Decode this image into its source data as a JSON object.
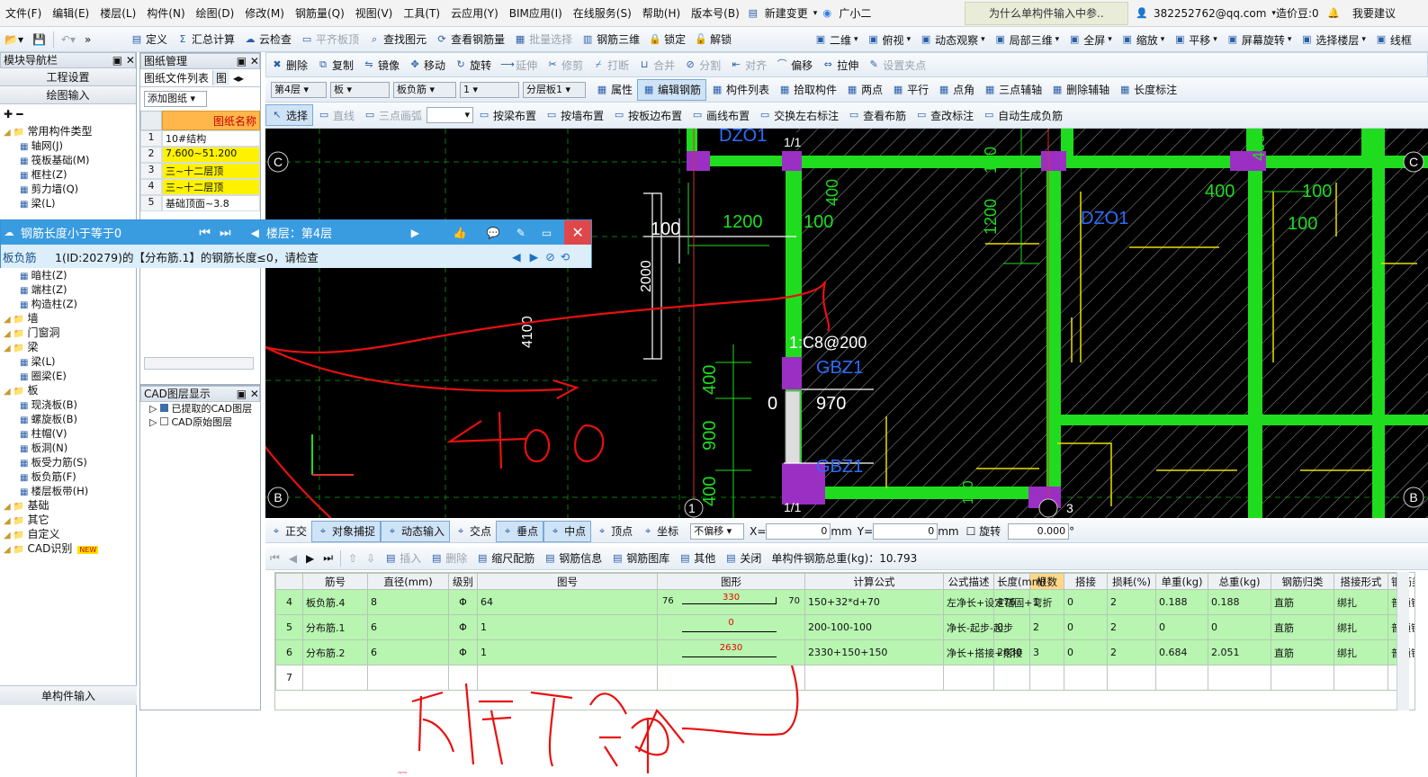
{
  "menu": [
    "文件(F)",
    "编辑(E)",
    "楼层(L)",
    "构件(N)",
    "绘图(D)",
    "修改(M)",
    "钢筋量(Q)",
    "视图(V)",
    "工具(T)",
    "云应用(Y)",
    "BIM应用(I)",
    "在线服务(S)",
    "帮助(H)",
    "版本号(B)"
  ],
  "menu_right": {
    "new_change": "新建变更",
    "xiaoer": "广小二",
    "question": "为什么单构件输入中参..",
    "account": "382252762@qq.com",
    "price_bean": "造价豆:0",
    "want_feedback": "我要建议"
  },
  "toolbar2": [
    "定义",
    "汇总计算",
    "云检查",
    "平齐板顶",
    "查找图元",
    "查看钢筋量",
    "批量选择",
    "钢筋三维",
    "锁定",
    "解锁"
  ],
  "toolbar2_right": [
    "二维",
    "俯视",
    "动态观察",
    "局部三维",
    "全屏",
    "缩放",
    "平移",
    "屏幕旋转",
    "选择楼层",
    "线框"
  ],
  "nav": {
    "title": "模块导航栏",
    "project_settings": "工程设置",
    "drawing_input": "绘图输入",
    "tree": [
      {
        "label": "常用构件类型",
        "level": 0
      },
      {
        "label": "轴网(J)",
        "level": 1
      },
      {
        "label": "筏板基础(M)",
        "level": 1
      },
      {
        "label": "框柱(Z)",
        "level": 1
      },
      {
        "label": "剪力墙(Q)",
        "level": 1
      },
      {
        "label": "梁(L)",
        "level": 1
      },
      {
        "label": "暗柱(Z)",
        "level": 1
      },
      {
        "label": "端柱(Z)",
        "level": 1
      },
      {
        "label": "构造柱(Z)",
        "level": 1
      },
      {
        "label": "墙",
        "level": 0
      },
      {
        "label": "门窗洞",
        "level": 0
      },
      {
        "label": "梁",
        "level": 0
      },
      {
        "label": "梁(L)",
        "level": 1
      },
      {
        "label": "圈梁(E)",
        "level": 1
      },
      {
        "label": "板",
        "level": 0
      },
      {
        "label": "现浇板(B)",
        "level": 1
      },
      {
        "label": "螺旋板(B)",
        "level": 1
      },
      {
        "label": "柱帽(V)",
        "level": 1
      },
      {
        "label": "板洞(N)",
        "level": 1
      },
      {
        "label": "板受力筋(S)",
        "level": 1
      },
      {
        "label": "板负筋(F)",
        "level": 1
      },
      {
        "label": "楼层板带(H)",
        "level": 1
      },
      {
        "label": "基础",
        "level": 0
      },
      {
        "label": "其它",
        "level": 0
      },
      {
        "label": "自定义",
        "level": 0
      },
      {
        "label": "CAD识别",
        "level": 0
      }
    ],
    "new_badge": "NEW",
    "single_input": "单构件输入"
  },
  "drawings": {
    "title": "图纸管理",
    "tab1": "图纸文件列表",
    "tab2": "图",
    "add": "添加图纸",
    "col": "图纸名称",
    "rows": [
      {
        "n": "1",
        "name": "10#结构"
      },
      {
        "n": "2",
        "name": "7.600~51.200"
      },
      {
        "n": "3",
        "name": "三~十二层顶"
      },
      {
        "n": "4",
        "name": "三~十二层顶"
      },
      {
        "n": "5",
        "name": "基础顶面~3.8"
      }
    ],
    "cad_title": "CAD图层显示",
    "cad_items": [
      "已提取的CAD图层",
      "CAD原始图层"
    ]
  },
  "editbar": [
    "删除",
    "复制",
    "镜像",
    "移动",
    "旋转",
    "延伸",
    "修剪",
    "打断",
    "合并",
    "分割",
    "对齐",
    "偏移",
    "拉伸",
    "设置夹点"
  ],
  "layerbar": {
    "floor": "第4层",
    "type": "板",
    "sub": "板负筋",
    "num": "1",
    "slab": "分层板1",
    "items": [
      "属性",
      "编辑钢筋",
      "构件列表",
      "拾取构件",
      "两点",
      "平行",
      "点角",
      "三点辅轴",
      "删除辅轴",
      "长度标注"
    ]
  },
  "drawbar": [
    "选择",
    "直线",
    "三点画弧",
    "按梁布置",
    "按墙布置",
    "按板边布置",
    "画线布置",
    "交换左右标注",
    "查看布筋",
    "查改标注",
    "自动生成负筋"
  ],
  "popup": {
    "title": "钢筋长度小于等于0",
    "floor": "楼层：第4层",
    "left": "板负筋",
    "msg": "1(ID:20279)的【分布筋.1】的钢筋长度≤0，请检查"
  },
  "cad": {
    "axis_left": [
      "C",
      "B"
    ],
    "axis_right": [
      "C",
      "B"
    ],
    "dims": [
      "100",
      "1200",
      "100",
      "2000",
      "4100",
      "400",
      "900",
      "400",
      "400",
      "100",
      "1200",
      "400",
      "100",
      "970",
      "0",
      "100",
      "1/1",
      "1/1",
      "1",
      "3",
      "100",
      "400"
    ],
    "rebar_label": "1:C8@200",
    "tags": [
      "DZO1",
      "DZO1",
      "GBZ1",
      "GBZ1"
    ],
    "handwriting": [
      "4100",
      "长度不合适"
    ]
  },
  "snapbar": {
    "items": [
      "正交",
      "对象捕捉",
      "动态输入",
      "交点",
      "垂点",
      "中点",
      "顶点",
      "坐标"
    ],
    "offset": "不偏移",
    "x_label": "X=",
    "x": "0",
    "mm1": "mm",
    "y_label": "Y=",
    "y": "0",
    "mm2": "mm",
    "rotate": "旋转",
    "rot": "0.000",
    "deg": "°"
  },
  "gridbar": {
    "items": [
      "插入",
      "删除",
      "缩尺配筋",
      "钢筋信息",
      "钢筋图库",
      "其他",
      "关闭"
    ],
    "total": "单构件钢筋总重(kg)：10.793"
  },
  "table": {
    "headers": [
      "筋号",
      "直径(mm)",
      "级别",
      "图号",
      "图形",
      "计算公式",
      "公式描述",
      "长度(mm)",
      "根数",
      "搭接",
      "损耗(%)",
      "单重(kg)",
      "总重(kg)",
      "钢筋归类",
      "搭接形式",
      "钢筋类型"
    ],
    "rows": [
      {
        "idx": "4",
        "name": "板负筋.4",
        "d": "8",
        "grade": "Φ",
        "fig": "64",
        "shape_l": "76",
        "shape_m": "330",
        "shape_r": "70",
        "formula": "150+32*d+70",
        "desc": "左净长+设定锚固+弯折",
        "len": "476",
        "count": "1",
        "lap": "0",
        "loss": "2",
        "uw": "0.188",
        "tw": "0.188",
        "cat": "直筋",
        "lapf": "绑扎",
        "type": "普通钢筋"
      },
      {
        "idx": "5",
        "name": "分布筋.1",
        "d": "6",
        "grade": "Φ",
        "fig": "1",
        "shape_l": "",
        "shape_m": "0",
        "shape_r": "",
        "formula": "200-100-100",
        "desc": "净长-起步-起步",
        "len": "0",
        "count": "2",
        "lap": "0",
        "loss": "2",
        "uw": "0",
        "tw": "0",
        "cat": "直筋",
        "lapf": "绑扎",
        "type": "普通钢筋"
      },
      {
        "idx": "6",
        "name": "分布筋.2",
        "d": "6",
        "grade": "Φ",
        "fig": "1",
        "shape_l": "",
        "shape_m": "2630",
        "shape_r": "",
        "formula": "2330+150+150",
        "desc": "净长+搭接+搭接",
        "len": "2630",
        "count": "3",
        "lap": "0",
        "loss": "2",
        "uw": "0.684",
        "tw": "2.051",
        "cat": "直筋",
        "lapf": "绑扎",
        "type": "普通钢筋"
      },
      {
        "idx": "7",
        "name": "",
        "d": "",
        "grade": "",
        "fig": "",
        "shape_l": "",
        "shape_m": "",
        "shape_r": "",
        "formula": "",
        "desc": "",
        "len": "",
        "count": "",
        "lap": "",
        "loss": "",
        "uw": "",
        "tw": "",
        "cat": "",
        "lapf": "",
        "type": ""
      }
    ]
  }
}
